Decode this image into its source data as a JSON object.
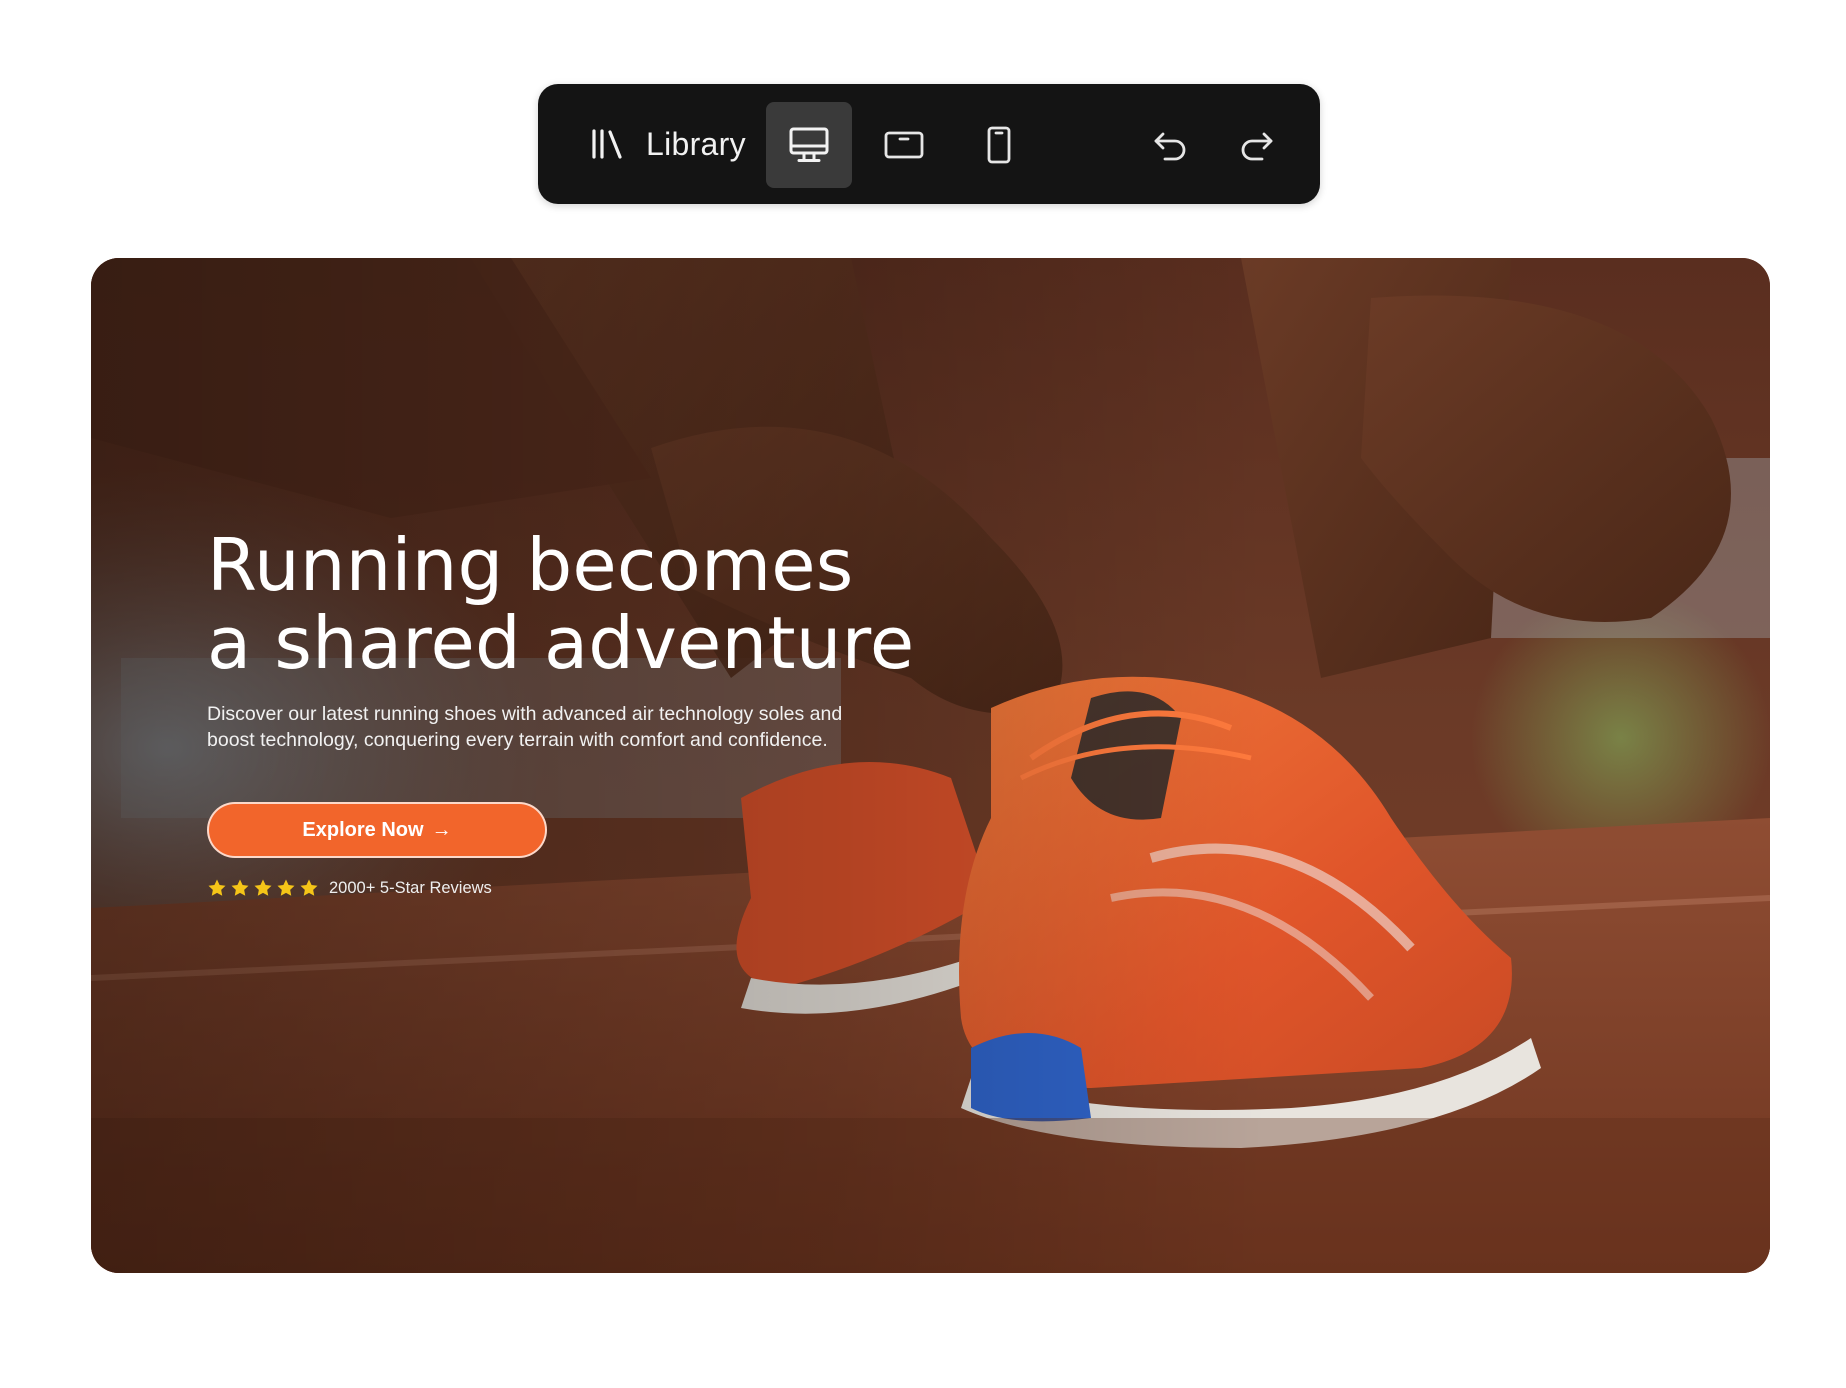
{
  "toolbar": {
    "library_label": "Library",
    "buttons": [
      {
        "icon": "desktop-icon",
        "active": true
      },
      {
        "icon": "tablet-icon",
        "active": false
      },
      {
        "icon": "mobile-icon",
        "active": false
      },
      {
        "icon": "undo-icon",
        "active": false
      },
      {
        "icon": "redo-icon",
        "active": false
      }
    ]
  },
  "hero": {
    "title_line1": "Running becomes",
    "title_line2": "a shared adventure",
    "description_line1": "Discover our latest running shoes with advanced air technology soles and",
    "description_line2": "boost technology, conquering every terrain with comfort and confidence.",
    "cta_label": "Explore Now",
    "cta_arrow": "→",
    "rating_stars": 5,
    "rating_text": "2000+ 5-Star Reviews"
  },
  "colors": {
    "toolbar_bg": "#141414",
    "toolbar_active": "#3a3a3a",
    "accent": "#f2652b",
    "star": "#f5c518",
    "track": "#8a4a30"
  }
}
